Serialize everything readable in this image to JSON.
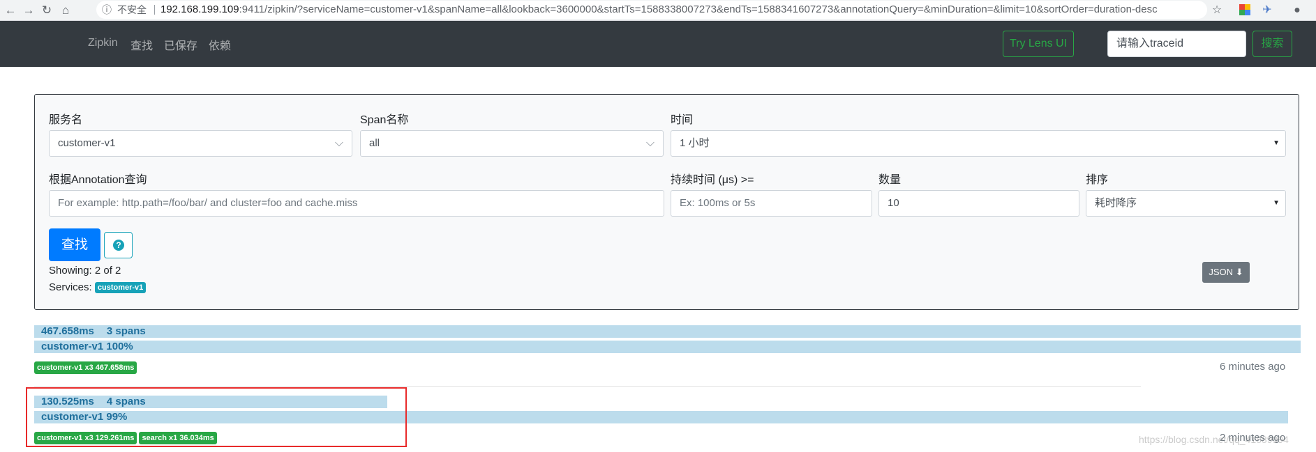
{
  "browser": {
    "info_icon": "info-icon",
    "insecure_label": "不安全",
    "host": "192.168.199.109",
    "path": ":9411/zipkin/?serviceName=customer-v1&spanName=all&lookback=3600000&startTs=1588338007273&endTs=1588341607273&annotationQuery=&minDuration=&limit=10&sortOrder=duration-desc"
  },
  "navbar": {
    "brand": "Zipkin",
    "links": [
      "查找",
      "已保存",
      "依赖"
    ],
    "lens_button": "Try Lens UI",
    "traceid_placeholder": "请输入traceid",
    "search_button": "搜索"
  },
  "form": {
    "service_label": "服务名",
    "service_value": "customer-v1",
    "span_label": "Span名称",
    "span_value": "all",
    "time_label": "时间",
    "time_value": "1 小时",
    "annotation_label": "根据Annotation查询",
    "annotation_placeholder": "For example: http.path=/foo/bar/ and cluster=foo and cache.miss",
    "duration_label": "持续时间 (μs) >=",
    "duration_placeholder": "Ex: 100ms or 5s",
    "limit_label": "数量",
    "limit_value": "10",
    "sort_label": "排序",
    "sort_value": "耗时降序",
    "find_button": "查找",
    "help_icon": "question-circle-icon",
    "showing": "Showing: 2 of 2",
    "services_label": "Services:",
    "services_badge": "customer-v1",
    "json_button": "JSON"
  },
  "traces": [
    {
      "duration": "467.658ms",
      "spans": "3 spans",
      "service_line": "customer-v1 100%",
      "duration_fraction": 1.0,
      "service_fraction": 1.0,
      "tags": [
        "customer-v1 x3 467.658ms"
      ],
      "ago": "6 minutes ago"
    },
    {
      "duration": "130.525ms",
      "spans": "4 spans",
      "service_line": "customer-v1 99%",
      "duration_fraction": 0.279,
      "service_fraction": 0.99,
      "tags": [
        "customer-v1 x3 129.261ms",
        "search x1 36.034ms"
      ],
      "ago": "2 minutes ago"
    }
  ],
  "watermark": "https://blog.csdn.net/qq_41889994",
  "colors": {
    "navbar": "#343a40",
    "success": "#28a745",
    "primary": "#007bff",
    "info": "#17a2b8",
    "trace_bar": "#bcdcec",
    "highlight": "#e82a2a"
  }
}
